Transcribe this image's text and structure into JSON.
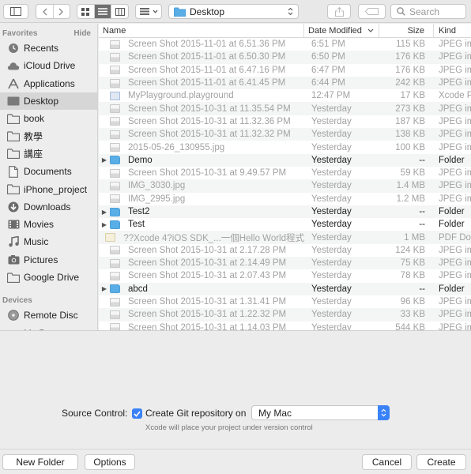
{
  "toolbar": {
    "location": "Desktop",
    "search_placeholder": "Search"
  },
  "sidebar": {
    "favorites_header": "Favorites",
    "hide_label": "Hide",
    "favorites": [
      {
        "label": "Recents",
        "icon": "clock-icon"
      },
      {
        "label": "iCloud Drive",
        "icon": "cloud-icon"
      },
      {
        "label": "Applications",
        "icon": "applications-icon"
      },
      {
        "label": "Desktop",
        "icon": "desktop-icon",
        "selected": true
      },
      {
        "label": "book",
        "icon": "folder-icon"
      },
      {
        "label": "教學",
        "icon": "folder-icon"
      },
      {
        "label": "講座",
        "icon": "folder-icon"
      },
      {
        "label": "Documents",
        "icon": "documents-icon"
      },
      {
        "label": "iPhone_project",
        "icon": "folder-icon"
      },
      {
        "label": "Downloads",
        "icon": "downloads-icon"
      },
      {
        "label": "Movies",
        "icon": "movies-icon"
      },
      {
        "label": "Music",
        "icon": "music-icon"
      },
      {
        "label": "Pictures",
        "icon": "pictures-icon"
      },
      {
        "label": "Google Drive",
        "icon": "folder-icon"
      }
    ],
    "devices_header": "Devices",
    "devices": [
      {
        "label": "Remote Disc",
        "icon": "disc-icon"
      },
      {
        "label": "My Passpo",
        "icon": "drive-icon"
      }
    ]
  },
  "columns": {
    "name": "Name",
    "date": "Date Modified",
    "size": "Size",
    "kind": "Kind"
  },
  "files": [
    {
      "name": "Screen Shot 2015-11-01 at 6.51.36 PM",
      "date": "6:51 PM",
      "size": "115 KB",
      "kind": "JPEG image",
      "type": "img"
    },
    {
      "name": "Screen Shot 2015-11-01 at 6.50.30 PM",
      "date": "6:50 PM",
      "size": "176 KB",
      "kind": "JPEG image",
      "type": "img"
    },
    {
      "name": "Screen Shot 2015-11-01 at 6.47.16 PM",
      "date": "6:47 PM",
      "size": "176 KB",
      "kind": "JPEG image",
      "type": "img"
    },
    {
      "name": "Screen Shot 2015-11-01 at 6.41.45 PM",
      "date": "6:44 PM",
      "size": "242 KB",
      "kind": "JPEG image",
      "type": "img"
    },
    {
      "name": "MyPlayground.playground",
      "date": "12:47 PM",
      "size": "17 KB",
      "kind": "Xcode Playground",
      "type": "play"
    },
    {
      "name": "Screen Shot 2015-10-31 at 11.35.54 PM",
      "date": "Yesterday",
      "size": "273 KB",
      "kind": "JPEG image",
      "type": "img"
    },
    {
      "name": "Screen Shot 2015-10-31 at 11.32.36 PM",
      "date": "Yesterday",
      "size": "187 KB",
      "kind": "JPEG image",
      "type": "img"
    },
    {
      "name": "Screen Shot 2015-10-31 at 11.32.32 PM",
      "date": "Yesterday",
      "size": "138 KB",
      "kind": "JPEG image",
      "type": "img"
    },
    {
      "name": "2015-05-26_130955.jpg",
      "date": "Yesterday",
      "size": "100 KB",
      "kind": "JPEG image",
      "type": "img"
    },
    {
      "name": "Demo",
      "date": "Yesterday",
      "size": "--",
      "kind": "Folder",
      "type": "folder"
    },
    {
      "name": "Screen Shot 2015-10-31 at 9.49.57 PM",
      "date": "Yesterday",
      "size": "59 KB",
      "kind": "JPEG image",
      "type": "img"
    },
    {
      "name": "IMG_3030.jpg",
      "date": "Yesterday",
      "size": "1.4 MB",
      "kind": "JPEG image",
      "type": "img"
    },
    {
      "name": "IMG_2995.jpg",
      "date": "Yesterday",
      "size": "1.2 MB",
      "kind": "JPEG image",
      "type": "img"
    },
    {
      "name": "Test2",
      "date": "Yesterday",
      "size": "--",
      "kind": "Folder",
      "type": "folder"
    },
    {
      "name": "Test",
      "date": "Yesterday",
      "size": "--",
      "kind": "Folder",
      "type": "folder"
    },
    {
      "name": "??Xcode 4?iOS SDK_...一個Hello World程式",
      "date": "Yesterday",
      "size": "1 MB",
      "kind": "PDF Document",
      "type": "doc"
    },
    {
      "name": "Screen Shot 2015-10-31 at 2.17.28 PM",
      "date": "Yesterday",
      "size": "124 KB",
      "kind": "JPEG image",
      "type": "img"
    },
    {
      "name": "Screen Shot 2015-10-31 at 2.14.49 PM",
      "date": "Yesterday",
      "size": "75 KB",
      "kind": "JPEG image",
      "type": "img"
    },
    {
      "name": "Screen Shot 2015-10-31 at 2.07.43 PM",
      "date": "Yesterday",
      "size": "78 KB",
      "kind": "JPEG image",
      "type": "img"
    },
    {
      "name": "abcd",
      "date": "Yesterday",
      "size": "--",
      "kind": "Folder",
      "type": "folder"
    },
    {
      "name": "Screen Shot 2015-10-31 at 1.31.41 PM",
      "date": "Yesterday",
      "size": "96 KB",
      "kind": "JPEG image",
      "type": "img"
    },
    {
      "name": "Screen Shot 2015-10-31 at 1.22.32 PM",
      "date": "Yesterday",
      "size": "33 KB",
      "kind": "JPEG image",
      "type": "img"
    },
    {
      "name": "Screen Shot 2015-10-31 at 1.14.03 PM",
      "date": "Yesterday",
      "size": "544 KB",
      "kind": "JPEG image",
      "type": "img"
    }
  ],
  "source_control": {
    "label": "Source Control:",
    "checkbox_label": "Create Git repository on",
    "checked": true,
    "target": "My Mac",
    "hint": "Xcode will place your project under version control"
  },
  "buttons": {
    "new_folder": "New Folder",
    "options": "Options",
    "cancel": "Cancel",
    "create": "Create"
  },
  "colors": {
    "accent": "#3a82f7",
    "folder": "#5aaee6",
    "selection": "#d6d6d6"
  }
}
